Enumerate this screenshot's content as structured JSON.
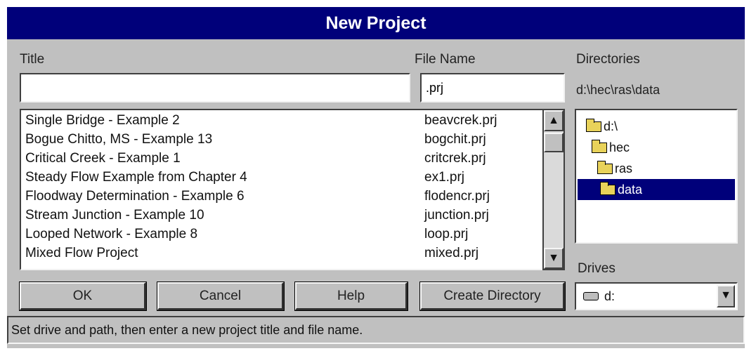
{
  "window": {
    "title": "New Project"
  },
  "labels": {
    "title": "Title",
    "file_name": "File Name",
    "directories": "Directories",
    "drives": "Drives"
  },
  "inputs": {
    "title_value": "",
    "file_name_value": ".prj"
  },
  "current_path": "d:\\hec\\ras\\data",
  "projects": [
    {
      "title": "Single Bridge - Example 2",
      "file": "beavcrek.prj"
    },
    {
      "title": "Bogue Chitto, MS - Example 13",
      "file": "bogchit.prj"
    },
    {
      "title": "Critical Creek - Example 1",
      "file": "critcrek.prj"
    },
    {
      "title": "Steady Flow Example from Chapter 4",
      "file": "ex1.prj"
    },
    {
      "title": "Floodway Determination - Example 6",
      "file": "flodencr.prj"
    },
    {
      "title": "Stream Junction - Example 10",
      "file": "junction.prj"
    },
    {
      "title": "Looped Network - Example 8",
      "file": "loop.prj"
    },
    {
      "title": "Mixed Flow Project",
      "file": "mixed.prj"
    }
  ],
  "directories": [
    {
      "name": "d:\\",
      "selected": false
    },
    {
      "name": "hec",
      "selected": false
    },
    {
      "name": "ras",
      "selected": false
    },
    {
      "name": "data",
      "selected": true
    }
  ],
  "drive": {
    "value": "d:"
  },
  "buttons": {
    "ok": "OK",
    "cancel": "Cancel",
    "help": "Help",
    "create_directory": "Create Directory"
  },
  "scroll_icons": {
    "up": "arrow-up-icon",
    "down": "arrow-down-icon"
  },
  "status_text": "Set drive and path, then enter a new project title and file name.",
  "colors": {
    "titlebar": "#00007a",
    "selection": "#00007a",
    "face": "#c0c0c0"
  }
}
